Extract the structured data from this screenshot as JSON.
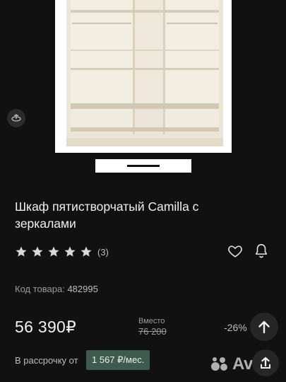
{
  "product": {
    "title": "Шкаф пятистворчатый Camilla с зеркалами",
    "rating_stars": 5,
    "rating_count": "(3)",
    "code_label": "Код товара:",
    "code_value": "482995",
    "price": "56 390₽",
    "old_price_label": "Вместо",
    "old_price": "76 200",
    "discount": "-26%",
    "installment_label": "В рассрочку от",
    "installment_value": "1 567 ₽/мес."
  },
  "gallery": {
    "active_index": 1
  },
  "watermark": {
    "text": "Avito"
  },
  "colors": {
    "background": "#111111",
    "installment_bg": "#3f5a4f",
    "star": "#d9d9d9"
  },
  "icons": [
    "ar-icon",
    "star-icon",
    "heart-icon",
    "bell-icon",
    "arrow-up-icon",
    "share-icon",
    "avito-logo-icon"
  ]
}
